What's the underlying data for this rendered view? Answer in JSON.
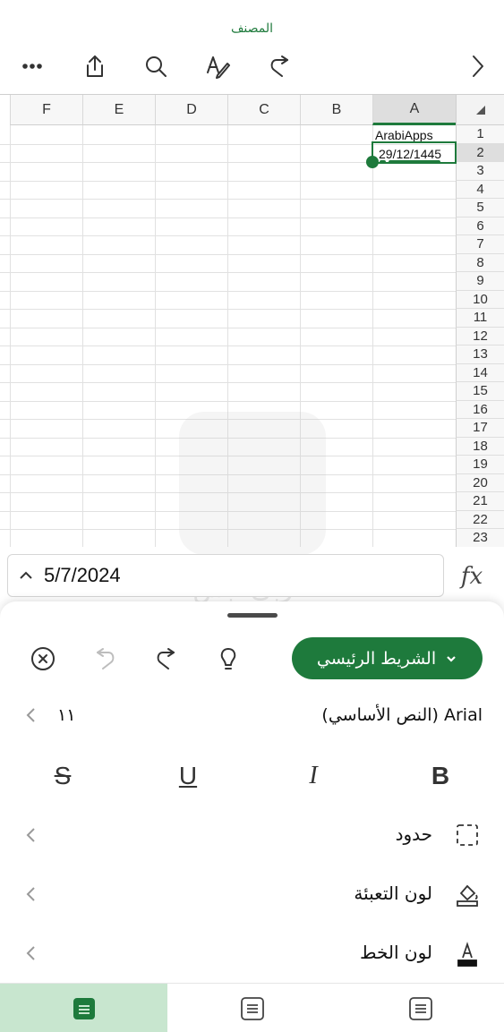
{
  "app": {
    "title": "المصنف",
    "accent": "#1e7a3c"
  },
  "toolbar": [
    {
      "name": "more-button",
      "icon": "more-icon"
    },
    {
      "name": "share-button",
      "icon": "share-icon"
    },
    {
      "name": "search-button",
      "icon": "search-icon"
    },
    {
      "name": "draw-button",
      "icon": "pen-icon"
    },
    {
      "name": "redo-button",
      "icon": "redo-icon"
    },
    {
      "name": "forward-button",
      "icon": "chevron-right-icon"
    }
  ],
  "grid": {
    "columns": [
      "F",
      "E",
      "D",
      "C",
      "B",
      "A"
    ],
    "selected_column": "A",
    "rows": [
      "1",
      "2",
      "3",
      "4",
      "5",
      "6",
      "7",
      "8",
      "9",
      "10",
      "11",
      "12",
      "13",
      "14",
      "15",
      "16",
      "17",
      "18",
      "19",
      "20",
      "21",
      "22",
      "23"
    ],
    "selected_row": "2",
    "cells": {
      "A1": "ArabiApps",
      "A2": "29/12/1445"
    }
  },
  "formula_bar": {
    "value": "5/7/2024",
    "fx_label": "fx"
  },
  "watermark": {
    "text": "عربي ابس"
  },
  "ribbon": {
    "tab_label": "الشريط الرئيسي",
    "font_name": "(النص الأساسي) Arial",
    "font_size": "١١",
    "format_buttons": {
      "bold": "B",
      "italic": "I",
      "underline": "U",
      "strike": "S"
    },
    "rows": [
      {
        "label": "حدود",
        "icon": "borders-icon"
      },
      {
        "label": "لون التعبئة",
        "icon": "fill-color-icon"
      },
      {
        "label": "لون الخط",
        "icon": "font-color-icon"
      }
    ]
  },
  "bottom_tabs": [
    {
      "name": "tab-home",
      "active": true
    },
    {
      "name": "tab-insert",
      "active": false
    },
    {
      "name": "tab-formulas",
      "active": false
    }
  ]
}
